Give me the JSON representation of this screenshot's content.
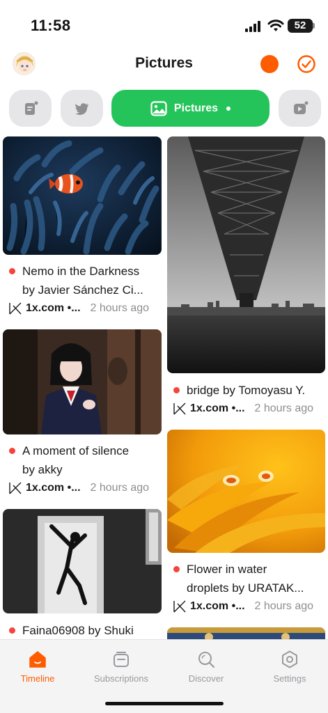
{
  "status": {
    "time": "11:58",
    "battery": "52"
  },
  "header": {
    "title": "Pictures"
  },
  "tabs": {
    "active_label": "Pictures"
  },
  "cards": [
    {
      "title_line1": "Nemo in the Darkness",
      "title_line2": "by Javier Sánchez Ci...",
      "source": "1x.com •...",
      "time": "2 hours ago"
    },
    {
      "title_line1": "bridge by Tomoyasu Y.",
      "source": "1x.com •...",
      "time": "2 hours ago"
    },
    {
      "title_line1": "A moment of silence",
      "title_line2": "by akky",
      "source": "1x.com •...",
      "time": "2 hours ago"
    },
    {
      "title_line1": "Flower in water",
      "title_line2": "droplets by URATAK...",
      "source": "1x.com •...",
      "time": "2 hours ago"
    },
    {
      "title_line1": "Faina06908 by Shuki"
    }
  ],
  "nav": [
    {
      "label": "Timeline",
      "icon": "home-icon",
      "active": true
    },
    {
      "label": "Subscriptions",
      "icon": "inbox-icon",
      "active": false
    },
    {
      "label": "Discover",
      "icon": "search-icon",
      "active": false
    },
    {
      "label": "Settings",
      "icon": "gear-icon",
      "active": false
    }
  ],
  "colors": {
    "accent": "#ff5c00",
    "green": "#25c45a",
    "unread": "#f4443b"
  }
}
